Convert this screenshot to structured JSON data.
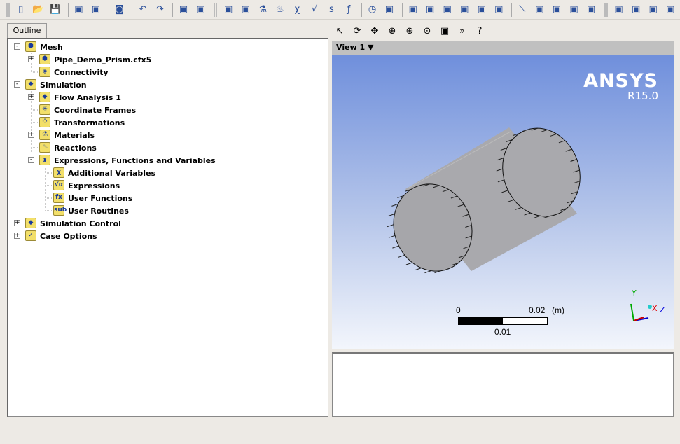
{
  "toolbar": {
    "groups": [
      [
        "new-file",
        "open-file",
        "save-file"
      ],
      [
        "open-case",
        "save-case"
      ],
      [
        "screenshot"
      ],
      [
        "undo",
        "redo"
      ],
      [
        "import-mesh",
        "transform-mesh"
      ],
      [
        "domain",
        "subdomain",
        "material",
        "reaction",
        "additional-variable",
        "expression",
        "user-routine",
        "user-function"
      ],
      [
        "solver-control",
        "output-control"
      ],
      [
        "boundary",
        "interface",
        "subdomain-box",
        "source-point",
        "mesh-adaption",
        "initialization"
      ],
      [
        "monitor",
        "run-definition",
        "solver-units",
        "mesh-region",
        "report"
      ],
      [
        "edit-run",
        "monitor-plot",
        "monitor-stop",
        "save-results"
      ]
    ]
  },
  "outline_tab": "Outline",
  "tree": [
    {
      "label": "Mesh",
      "depth": 0,
      "exp": "-",
      "icon": "mesh-folder-icon",
      "glyph": "⬢"
    },
    {
      "label": "Pipe_Demo_Prism.cfx5",
      "depth": 1,
      "exp": "+",
      "icon": "mesh-file-icon",
      "glyph": "⬢"
    },
    {
      "label": "Connectivity",
      "depth": 1,
      "exp": "",
      "icon": "connectivity-icon",
      "glyph": "◈"
    },
    {
      "label": "Simulation",
      "depth": 0,
      "exp": "-",
      "icon": "simulation-folder-icon",
      "glyph": "◆"
    },
    {
      "label": "Flow Analysis 1",
      "depth": 1,
      "exp": "+",
      "icon": "flow-analysis-icon",
      "glyph": "◆"
    },
    {
      "label": "Coordinate Frames",
      "depth": 1,
      "exp": "",
      "icon": "coordinate-frames-icon",
      "glyph": "✳"
    },
    {
      "label": "Transformations",
      "depth": 1,
      "exp": "",
      "icon": "transformations-icon",
      "glyph": "⁘"
    },
    {
      "label": "Materials",
      "depth": 1,
      "exp": "+",
      "icon": "materials-icon",
      "glyph": "⚗"
    },
    {
      "label": "Reactions",
      "depth": 1,
      "exp": "",
      "icon": "reactions-icon",
      "glyph": "♨"
    },
    {
      "label": "Expressions, Functions and Variables",
      "depth": 1,
      "exp": "-",
      "icon": "expressions-folder-icon",
      "glyph": "χ"
    },
    {
      "label": "Additional Variables",
      "depth": 2,
      "exp": "",
      "icon": "additional-variables-icon",
      "glyph": "χ"
    },
    {
      "label": "Expressions",
      "depth": 2,
      "exp": "",
      "icon": "expressions-icon",
      "glyph": "√α"
    },
    {
      "label": "User Functions",
      "depth": 2,
      "exp": "",
      "icon": "user-functions-icon",
      "glyph": "fx"
    },
    {
      "label": "User Routines",
      "depth": 2,
      "exp": "",
      "icon": "user-routines-icon",
      "glyph": "sub"
    },
    {
      "label": "Simulation Control",
      "depth": 0,
      "exp": "+",
      "icon": "simulation-control-icon",
      "glyph": "◆"
    },
    {
      "label": "Case Options",
      "depth": 0,
      "exp": "+",
      "icon": "case-options-icon",
      "glyph": "✓"
    }
  ],
  "viewer": {
    "tools": [
      "select",
      "rotate",
      "pan",
      "zoom",
      "zoom-box",
      "zoom-fit",
      "fit-view",
      "more",
      "help"
    ],
    "view_label": "View 1",
    "brand": "ANSYS",
    "version": "R15.0",
    "scale": {
      "start": "0",
      "end": "0.02",
      "unit": "(m)",
      "mid": "0.01"
    },
    "axes": {
      "y": "Y",
      "x": "X",
      "z": "Z"
    }
  }
}
